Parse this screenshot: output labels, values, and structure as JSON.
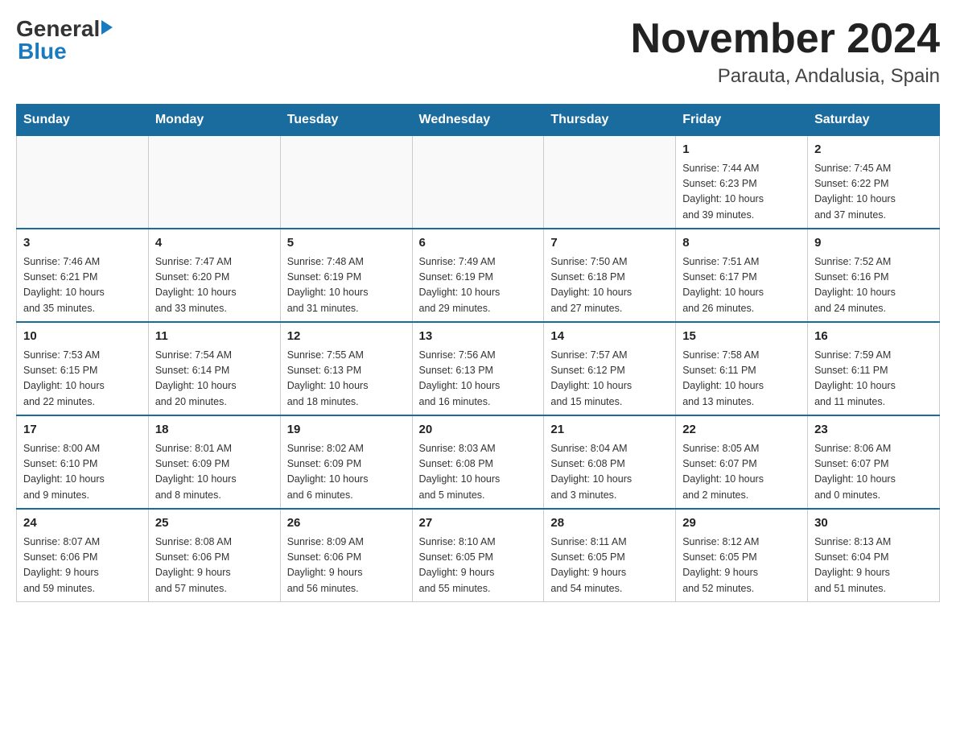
{
  "logo": {
    "line1": "General",
    "line2": "Blue"
  },
  "title": "November 2024",
  "subtitle": "Parauta, Andalusia, Spain",
  "weekdays": [
    "Sunday",
    "Monday",
    "Tuesday",
    "Wednesday",
    "Thursday",
    "Friday",
    "Saturday"
  ],
  "weeks": [
    [
      {
        "day": "",
        "info": ""
      },
      {
        "day": "",
        "info": ""
      },
      {
        "day": "",
        "info": ""
      },
      {
        "day": "",
        "info": ""
      },
      {
        "day": "",
        "info": ""
      },
      {
        "day": "1",
        "info": "Sunrise: 7:44 AM\nSunset: 6:23 PM\nDaylight: 10 hours\nand 39 minutes."
      },
      {
        "day": "2",
        "info": "Sunrise: 7:45 AM\nSunset: 6:22 PM\nDaylight: 10 hours\nand 37 minutes."
      }
    ],
    [
      {
        "day": "3",
        "info": "Sunrise: 7:46 AM\nSunset: 6:21 PM\nDaylight: 10 hours\nand 35 minutes."
      },
      {
        "day": "4",
        "info": "Sunrise: 7:47 AM\nSunset: 6:20 PM\nDaylight: 10 hours\nand 33 minutes."
      },
      {
        "day": "5",
        "info": "Sunrise: 7:48 AM\nSunset: 6:19 PM\nDaylight: 10 hours\nand 31 minutes."
      },
      {
        "day": "6",
        "info": "Sunrise: 7:49 AM\nSunset: 6:19 PM\nDaylight: 10 hours\nand 29 minutes."
      },
      {
        "day": "7",
        "info": "Sunrise: 7:50 AM\nSunset: 6:18 PM\nDaylight: 10 hours\nand 27 minutes."
      },
      {
        "day": "8",
        "info": "Sunrise: 7:51 AM\nSunset: 6:17 PM\nDaylight: 10 hours\nand 26 minutes."
      },
      {
        "day": "9",
        "info": "Sunrise: 7:52 AM\nSunset: 6:16 PM\nDaylight: 10 hours\nand 24 minutes."
      }
    ],
    [
      {
        "day": "10",
        "info": "Sunrise: 7:53 AM\nSunset: 6:15 PM\nDaylight: 10 hours\nand 22 minutes."
      },
      {
        "day": "11",
        "info": "Sunrise: 7:54 AM\nSunset: 6:14 PM\nDaylight: 10 hours\nand 20 minutes."
      },
      {
        "day": "12",
        "info": "Sunrise: 7:55 AM\nSunset: 6:13 PM\nDaylight: 10 hours\nand 18 minutes."
      },
      {
        "day": "13",
        "info": "Sunrise: 7:56 AM\nSunset: 6:13 PM\nDaylight: 10 hours\nand 16 minutes."
      },
      {
        "day": "14",
        "info": "Sunrise: 7:57 AM\nSunset: 6:12 PM\nDaylight: 10 hours\nand 15 minutes."
      },
      {
        "day": "15",
        "info": "Sunrise: 7:58 AM\nSunset: 6:11 PM\nDaylight: 10 hours\nand 13 minutes."
      },
      {
        "day": "16",
        "info": "Sunrise: 7:59 AM\nSunset: 6:11 PM\nDaylight: 10 hours\nand 11 minutes."
      }
    ],
    [
      {
        "day": "17",
        "info": "Sunrise: 8:00 AM\nSunset: 6:10 PM\nDaylight: 10 hours\nand 9 minutes."
      },
      {
        "day": "18",
        "info": "Sunrise: 8:01 AM\nSunset: 6:09 PM\nDaylight: 10 hours\nand 8 minutes."
      },
      {
        "day": "19",
        "info": "Sunrise: 8:02 AM\nSunset: 6:09 PM\nDaylight: 10 hours\nand 6 minutes."
      },
      {
        "day": "20",
        "info": "Sunrise: 8:03 AM\nSunset: 6:08 PM\nDaylight: 10 hours\nand 5 minutes."
      },
      {
        "day": "21",
        "info": "Sunrise: 8:04 AM\nSunset: 6:08 PM\nDaylight: 10 hours\nand 3 minutes."
      },
      {
        "day": "22",
        "info": "Sunrise: 8:05 AM\nSunset: 6:07 PM\nDaylight: 10 hours\nand 2 minutes."
      },
      {
        "day": "23",
        "info": "Sunrise: 8:06 AM\nSunset: 6:07 PM\nDaylight: 10 hours\nand 0 minutes."
      }
    ],
    [
      {
        "day": "24",
        "info": "Sunrise: 8:07 AM\nSunset: 6:06 PM\nDaylight: 9 hours\nand 59 minutes."
      },
      {
        "day": "25",
        "info": "Sunrise: 8:08 AM\nSunset: 6:06 PM\nDaylight: 9 hours\nand 57 minutes."
      },
      {
        "day": "26",
        "info": "Sunrise: 8:09 AM\nSunset: 6:06 PM\nDaylight: 9 hours\nand 56 minutes."
      },
      {
        "day": "27",
        "info": "Sunrise: 8:10 AM\nSunset: 6:05 PM\nDaylight: 9 hours\nand 55 minutes."
      },
      {
        "day": "28",
        "info": "Sunrise: 8:11 AM\nSunset: 6:05 PM\nDaylight: 9 hours\nand 54 minutes."
      },
      {
        "day": "29",
        "info": "Sunrise: 8:12 AM\nSunset: 6:05 PM\nDaylight: 9 hours\nand 52 minutes."
      },
      {
        "day": "30",
        "info": "Sunrise: 8:13 AM\nSunset: 6:04 PM\nDaylight: 9 hours\nand 51 minutes."
      }
    ]
  ]
}
